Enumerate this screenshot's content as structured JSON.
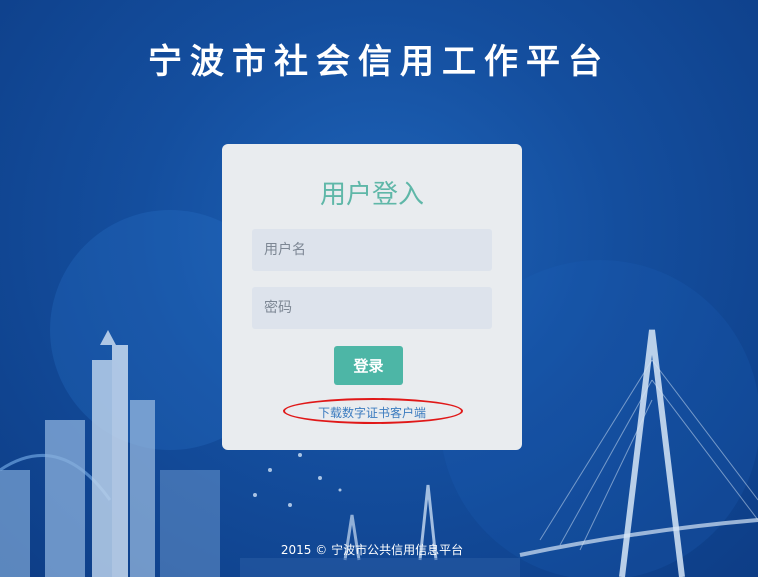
{
  "header": {
    "title": "宁波市社会信用工作平台"
  },
  "login": {
    "title": "用户登入",
    "username_placeholder": "用户名",
    "password_placeholder": "密码",
    "submit_label": "登录",
    "download_link": "下载数字证书客户端"
  },
  "footer": {
    "copyright": "2015 © 宁波市公共信用信息平台"
  },
  "colors": {
    "background": "#144e9e",
    "card": "#e9ecef",
    "accent": "#4db6a6",
    "annotation": "#e01818"
  }
}
